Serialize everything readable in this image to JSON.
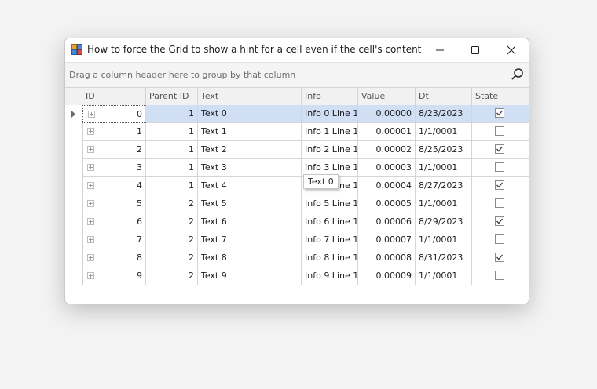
{
  "window": {
    "title": "How to force the Grid to show a hint for a cell even if the cell's content is com..."
  },
  "group_panel": {
    "text": "Drag a column header here to group by that column"
  },
  "columns": [
    "ID",
    "Parent ID",
    "Text",
    "Info",
    "Value",
    "Dt",
    "State"
  ],
  "rows": [
    {
      "id": "0",
      "parent_id": "1",
      "text": "Text 0",
      "info": "Info 0 Line 1",
      "value": "0.00000",
      "dt": "8/23/2023",
      "state": true
    },
    {
      "id": "1",
      "parent_id": "1",
      "text": "Text 1",
      "info": "Info 1 Line 1",
      "value": "0.00001",
      "dt": "1/1/0001",
      "state": false
    },
    {
      "id": "2",
      "parent_id": "1",
      "text": "Text 2",
      "info": "Info 2 Line 1",
      "value": "0.00002",
      "dt": "8/25/2023",
      "state": true
    },
    {
      "id": "3",
      "parent_id": "1",
      "text": "Text 3",
      "info": "Info 3 Line 1",
      "value": "0.00003",
      "dt": "1/1/0001",
      "state": false
    },
    {
      "id": "4",
      "parent_id": "1",
      "text": "Text 4",
      "info": "Info 4 Line 1",
      "value": "0.00004",
      "dt": "8/27/2023",
      "state": true
    },
    {
      "id": "5",
      "parent_id": "2",
      "text": "Text 5",
      "info": "Info 5 Line 1",
      "value": "0.00005",
      "dt": "1/1/0001",
      "state": false
    },
    {
      "id": "6",
      "parent_id": "2",
      "text": "Text 6",
      "info": "Info 6 Line 1",
      "value": "0.00006",
      "dt": "8/29/2023",
      "state": true
    },
    {
      "id": "7",
      "parent_id": "2",
      "text": "Text 7",
      "info": "Info 7 Line 1",
      "value": "0.00007",
      "dt": "1/1/0001",
      "state": false
    },
    {
      "id": "8",
      "parent_id": "2",
      "text": "Text 8",
      "info": "Info 8 Line 1",
      "value": "0.00008",
      "dt": "8/31/2023",
      "state": true
    },
    {
      "id": "9",
      "parent_id": "2",
      "text": "Text 9",
      "info": "Info 9 Line 1",
      "value": "0.00009",
      "dt": "1/1/0001",
      "state": false
    }
  ],
  "focused_row": 0,
  "tooltip": {
    "text": "Text 0"
  },
  "icons": {
    "app": "app-icon",
    "minimize": "minimize-icon",
    "maximize": "maximize-icon",
    "close": "close-icon",
    "search": "search-icon",
    "row_indicator": "row-indicator-arrow-icon",
    "expand": "expand-icon",
    "checkmark": "checkmark-icon"
  },
  "colors": {
    "focused_row": "#d1dff5",
    "header_bg": "#f1f1f1",
    "group_panel_bg": "#f4f4f4"
  }
}
